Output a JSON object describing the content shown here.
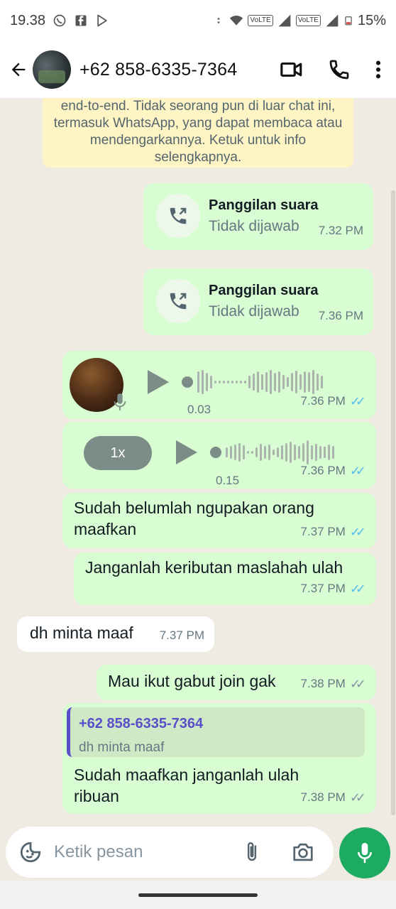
{
  "status_bar": {
    "time": "19.38",
    "volte_1": "VoLTE",
    "volte_2": "VoLTE",
    "battery": "15%"
  },
  "header": {
    "contact": "+62 858-6335-7364"
  },
  "system_note": "end-to-end. Tidak seorang pun di luar chat ini, termasuk WhatsApp, yang dapat membaca atau mendengarkannya. Ketuk untuk info selengkapnya.",
  "messages": {
    "call1": {
      "title": "Panggilan suara",
      "status": "Tidak dijawab",
      "time": "7.32 PM"
    },
    "call2": {
      "title": "Panggilan suara",
      "status": "Tidak dijawab",
      "time": "7.36 PM"
    },
    "voice1": {
      "duration": "0.03",
      "time": "7.36 PM"
    },
    "voice2": {
      "speed": "1x",
      "duration": "0.15",
      "time": "7.36 PM"
    },
    "msg1": {
      "text": "Sudah belumlah ngupakan orang maafkan",
      "time": "7.37 PM"
    },
    "msg2": {
      "text": "Janganlah keributan maslahah ulah",
      "time": "7.37 PM"
    },
    "msg3": {
      "text": "dh minta maaf",
      "time": "7.37 PM"
    },
    "msg4": {
      "text": "Mau ikut gabut join gak",
      "time": "7.38 PM"
    },
    "msg5": {
      "quote_name": "+62 858-6335-7364",
      "quote_text": "dh minta maaf",
      "text": "Sudah maafkan janganlah ulah ribuan",
      "time": "7.38 PM"
    }
  },
  "input": {
    "placeholder": "Ketik pesan"
  },
  "colors": {
    "outgoing_bubble": "#d9fdd3",
    "incoming_bubble": "#ffffff",
    "chat_background": "#efeae2",
    "read_ticks": "#53bdeb",
    "mic_button": "#1daa61"
  }
}
